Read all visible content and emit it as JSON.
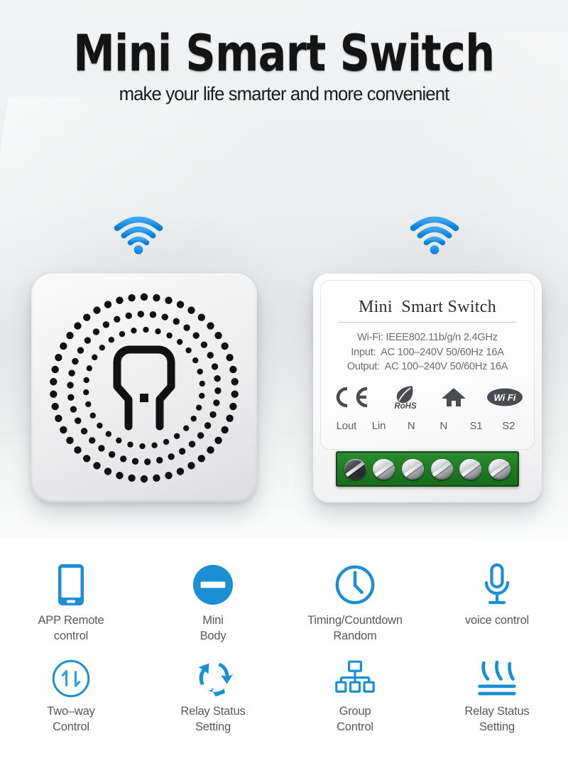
{
  "header": {
    "title": "Mini Smart Switch",
    "subtitle": "make your life smarter and more convenient"
  },
  "colors": {
    "accent_blue": "#1b8fd4",
    "terminal_green": "#1f7d25",
    "headline": "#141414",
    "feature_label": "#58585a",
    "spec_text": "#6c6e71"
  },
  "hero": {
    "wifi_left": {
      "icon": "wifi-icon"
    },
    "wifi_right": {
      "icon": "wifi-icon"
    },
    "device_left": {
      "name": "smart-switch-front-panel",
      "center_icon": "plug-socket-icon"
    },
    "device_right": {
      "name": "smart-switch-label-module",
      "label_title": "Mini  Smart Switch",
      "specs": [
        "Wi-Fi: IEEE802.11b/g/n 2.4GHz",
        "Input:  AC 100–240V 50/60Hz 16A",
        "Output:  AC 100–240V 50/60Hz 16A"
      ],
      "certifications": [
        {
          "name": "ce-mark-icon",
          "label": "CE"
        },
        {
          "name": "rohs-leaf-icon",
          "label": "RoHS"
        },
        {
          "name": "home-house-icon",
          "label": "Home"
        },
        {
          "name": "wifi-badge-icon",
          "label": "WiFi"
        }
      ],
      "terminals": [
        "Lout",
        "Lin",
        "N",
        "N",
        "S1",
        "S2"
      ],
      "screw_count": 6
    }
  },
  "features": {
    "row1": [
      {
        "icon": "smartphone-icon",
        "label": "APP Remote\ncontrol"
      },
      {
        "icon": "minus-circle-icon",
        "label": "Mini\nBody"
      },
      {
        "icon": "clock-icon",
        "label": "Timing/Countdown\nRandom"
      },
      {
        "icon": "microphone-icon",
        "label": "voice control"
      }
    ],
    "row2": [
      {
        "icon": "two-way-arrows-icon",
        "label": "Two–way\nControl"
      },
      {
        "icon": "refresh-cycle-icon",
        "label": "Relay Status\nSetting"
      },
      {
        "icon": "org-hierarchy-icon",
        "label": "Group\nControl"
      },
      {
        "icon": "heat-waves-icon",
        "label": "Relay Status\nSetting"
      }
    ]
  }
}
